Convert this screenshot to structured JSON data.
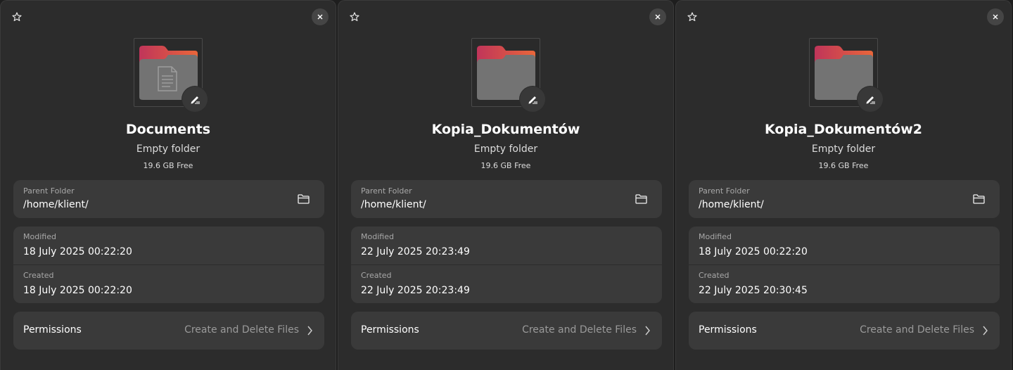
{
  "colors": {
    "panel_bg": "#2c2c2c",
    "card_bg": "#3a3a3a",
    "folder_top": "#c0355a",
    "folder_top_right": "#e9663a",
    "folder_body": "#727272"
  },
  "icons": {
    "star": "star-outline-icon",
    "close": "close-icon",
    "rename": "pencil-icon",
    "open_folder": "folder-open-icon",
    "chevron": "chevron-right-icon",
    "document": "document-icon"
  },
  "panels": [
    {
      "name": "Documents",
      "type": "Empty folder",
      "free": "19.6 GB Free",
      "has_document_glyph": true,
      "parent": {
        "label": "Parent Folder",
        "value": "/home/klient/"
      },
      "modified": {
        "label": "Modified",
        "value": "18 July 2025 00:22:20"
      },
      "created": {
        "label": "Created",
        "value": "18 July 2025 00:22:20"
      },
      "permissions": {
        "label": "Permissions",
        "value": "Create and Delete Files"
      }
    },
    {
      "name": "Kopia_Dokumentów",
      "type": "Empty folder",
      "free": "19.6 GB Free",
      "has_document_glyph": false,
      "parent": {
        "label": "Parent Folder",
        "value": "/home/klient/"
      },
      "modified": {
        "label": "Modified",
        "value": "22 July 2025 20:23:49"
      },
      "created": {
        "label": "Created",
        "value": "22 July 2025 20:23:49"
      },
      "permissions": {
        "label": "Permissions",
        "value": "Create and Delete Files"
      }
    },
    {
      "name": "Kopia_Dokumentów2",
      "type": "Empty folder",
      "free": "19.6 GB Free",
      "has_document_glyph": false,
      "parent": {
        "label": "Parent Folder",
        "value": "/home/klient/"
      },
      "modified": {
        "label": "Modified",
        "value": "18 July 2025 00:22:20"
      },
      "created": {
        "label": "Created",
        "value": "22 July 2025 20:30:45"
      },
      "permissions": {
        "label": "Permissions",
        "value": "Create and Delete Files"
      }
    }
  ]
}
